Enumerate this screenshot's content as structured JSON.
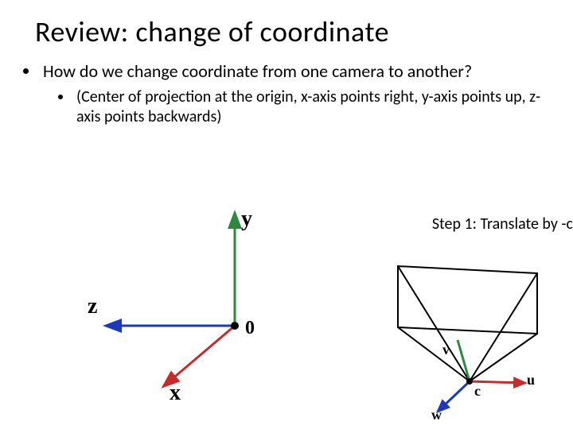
{
  "title": "Review: change of coordinate",
  "bullets": {
    "q": "How do we change coordinate from one camera to another?",
    "sub": "(Center of projection at the origin, x-axis points right, y-axis points up, z-axis points backwards)"
  },
  "step": "Step 1: Translate by -c",
  "axes": {
    "x": "x",
    "y": "y",
    "z": "z",
    "origin": "0"
  },
  "camera": {
    "v": "v",
    "w": "w",
    "u": "u",
    "c": "c"
  },
  "colors": {
    "x": "#c92a2a",
    "y": "#2b8a3e",
    "z": "#1c39bb",
    "dot": "#000000",
    "cam": "#1c39bb"
  }
}
